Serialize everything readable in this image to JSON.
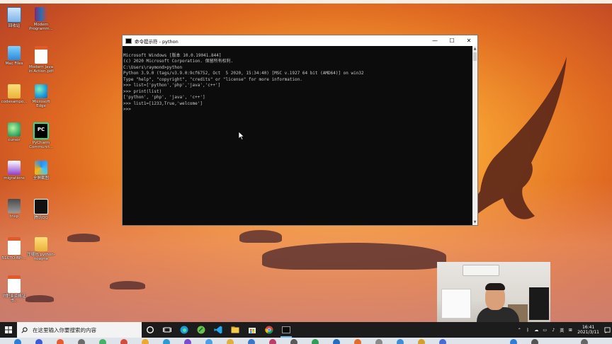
{
  "desktop": {
    "icons": [
      {
        "label": "回收站",
        "glyph": "recycle-bin-icon"
      },
      {
        "label": "Modern Programm...",
        "glyph": "winrar-icon"
      },
      {
        "label": "Mac Files",
        "glyph": "folder-blue-icon"
      },
      {
        "label": "Modern Java in Action.pdf",
        "glyph": "pdf-icon"
      },
      {
        "label": "codesampo...",
        "glyph": "folder-icon"
      },
      {
        "label": "Microsoft Edge",
        "glyph": "edge-icon"
      },
      {
        "label": "cursor",
        "glyph": "cursor-app-icon"
      },
      {
        "label": "PyCharm Communit...",
        "glyph": "pycharm-icon"
      },
      {
        "label": "migrations",
        "glyph": "migrations-icon"
      },
      {
        "label": "全屏截图",
        "glyph": "screenshot-icon"
      },
      {
        "label": "tnsp",
        "glyph": "file-icon"
      },
      {
        "label": "腾讯QQ",
        "glyph": "qq-icon"
      },
      {
        "label": "51CTO-BP-...",
        "glyph": "pdf-icon"
      },
      {
        "label": "压缩包 python-noayne",
        "glyph": "archive-icon"
      },
      {
        "label": "IT职业资格证书...",
        "glyph": "pdf-icon"
      }
    ]
  },
  "cmd_window": {
    "title": "命令提示符 - python",
    "buttons": {
      "minimize": "—",
      "maximize": "☐",
      "close": "✕"
    },
    "lines": [
      "Microsoft Windows [版本 10.0.19041.844]",
      "(c) 2020 Microsoft Corporation. 保留所有权利.",
      "",
      "C:\\Users\\raymond>python",
      "Python 3.9.0 (tags/v3.9.0:9cf6752, Oct  5 2020, 15:34:40) [MSC v.1927 64 bit (AMD64)] on win32",
      "Type \"help\", \"copyright\", \"credits\" or \"license\" for more information.",
      ">>> list=['python','php','java','c++']",
      ">>> print(list)",
      "['python', 'php', 'java', 'c++']",
      ">>> list1=[1233,True,'welcome']",
      ">>> "
    ]
  },
  "taskbar": {
    "search_placeholder": "在这里输入你要搜索的内容",
    "apps": [
      "cortana-icon",
      "task-view-icon",
      "edge-icon",
      "cursor-app-icon",
      "vscode-icon",
      "file-explorer-icon",
      "store-icon",
      "chrome-icon",
      "terminal-icon"
    ],
    "tray": {
      "ime": "英",
      "time": "16:41",
      "date": "2021/3/11"
    }
  },
  "colors": {
    "console_bg": "#0c0c0c",
    "console_fg": "#c9c9c9",
    "taskbar_bg": "#1c1c1c"
  }
}
